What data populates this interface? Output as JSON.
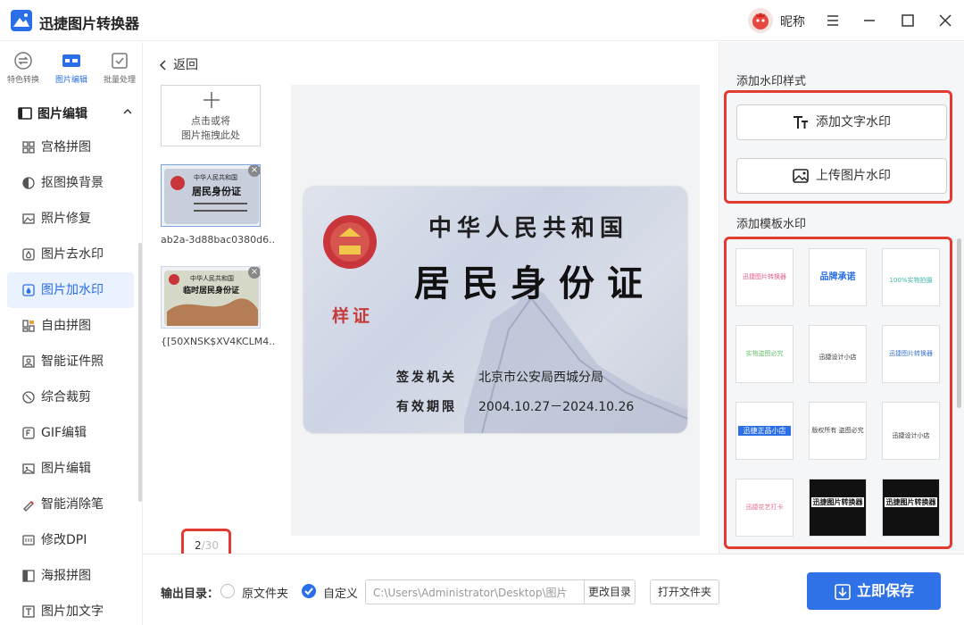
{
  "app": {
    "title": "迅捷图片转换器",
    "nickname": "昵称"
  },
  "top_tabs": [
    {
      "label": "特色转换",
      "icon": "convert-icon"
    },
    {
      "label": "图片编辑",
      "icon": "image-edit-icon",
      "active": true
    },
    {
      "label": "批量处理",
      "icon": "batch-icon"
    }
  ],
  "sidebar": {
    "section": "图片编辑",
    "items": [
      {
        "label": "宫格拼图",
        "icon": "grid-icon"
      },
      {
        "label": "抠图换背景",
        "icon": "cutout-icon"
      },
      {
        "label": "照片修复",
        "icon": "photo-repair-icon"
      },
      {
        "label": "图片去水印",
        "icon": "remove-watermark-icon"
      },
      {
        "label": "图片加水印",
        "icon": "add-watermark-icon",
        "active": true
      },
      {
        "label": "自由拼图",
        "icon": "free-collage-icon"
      },
      {
        "label": "智能证件照",
        "icon": "id-photo-icon"
      },
      {
        "label": "综合裁剪",
        "icon": "crop-icon"
      },
      {
        "label": "GIF编辑",
        "icon": "gif-icon"
      },
      {
        "label": "图片编辑",
        "icon": "image-edit-icon"
      },
      {
        "label": "智能消除笔",
        "icon": "eraser-pen-icon"
      },
      {
        "label": "修改DPI",
        "icon": "dpi-icon"
      },
      {
        "label": "海报拼图",
        "icon": "poster-icon"
      },
      {
        "label": "图片加文字",
        "icon": "add-text-icon"
      }
    ]
  },
  "main": {
    "back_label": "返回",
    "upload_text_line1": "点击或将",
    "upload_text_line2": "图片拖拽此处",
    "thumbnails": [
      {
        "name": "ab2a-3d88bac0380d6...",
        "title1": "中华人民共和国",
        "title2": "居民身份证"
      },
      {
        "name": "{[50XNSK$XV4KCLM4...",
        "title1": "中华人民共和国",
        "title2": "临时居民身份证"
      }
    ],
    "page_current": "2",
    "page_total": "/30",
    "card": {
      "line1": "中华人民共和国",
      "line2": "居民身份证",
      "stamp": "样证",
      "issuer_key": "签发机关",
      "issuer_value": "北京市公安局西城分局",
      "valid_key": "有效期限",
      "valid_value": "2004.10.27－2024.10.26"
    }
  },
  "right_panel": {
    "style_label": "添加水印样式",
    "add_text_btn": "添加文字水印",
    "upload_img_btn": "上传图片水印",
    "template_label": "添加模板水印",
    "templates": [
      {
        "text": "迅捷图片转换器",
        "color": "#e85a8a"
      },
      {
        "text": "品牌承诺",
        "color": "#2a6ee8"
      },
      {
        "text": "100%实物拍摄",
        "color": "#3fb6a8"
      },
      {
        "text": "实物盗图必究",
        "color": "#6cc16c"
      },
      {
        "text": "迅捷设计小店",
        "color": "#333333"
      },
      {
        "text": "迅捷图片转换器",
        "color": "#3a6fd0"
      },
      {
        "text": "迅捷正品小店",
        "color": "#2a6ee8"
      },
      {
        "text": "版权所有 盗图必究",
        "color": "#444444"
      },
      {
        "text": "迅捷设计小店",
        "color": "#333333"
      },
      {
        "text": "迅捷花艺打卡",
        "color": "#e86a8a"
      },
      {
        "text": "迅捷图片转换器",
        "color": "#111111"
      },
      {
        "text": "迅捷图片转换器",
        "color": "#111111"
      }
    ]
  },
  "bottom": {
    "output_label": "输出目录：",
    "option_original": "原文件夹",
    "option_custom": "自定义",
    "path_value": "C:\\Users\\Administrator\\Desktop\\图片",
    "change_dir_btn": "更改目录",
    "open_folder_btn": "打开文件夹",
    "save_btn": "立即保存"
  },
  "colors": {
    "accent": "#2a6ee8",
    "highlight": "#e23b32",
    "save": "#2f72e8"
  }
}
